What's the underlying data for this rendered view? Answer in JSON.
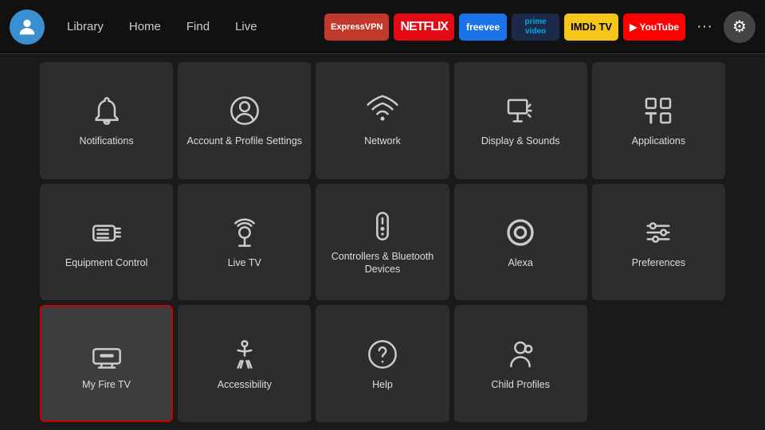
{
  "nav": {
    "links": [
      "Library",
      "Home",
      "Find",
      "Live"
    ],
    "apps": [
      {
        "id": "expressvpn",
        "label": "ExpressVPN",
        "class": "badge-expressvpn"
      },
      {
        "id": "netflix",
        "label": "NETFLIX",
        "class": "badge-netflix"
      },
      {
        "id": "freevee",
        "label": "freevee",
        "class": "badge-freevee"
      },
      {
        "id": "prime",
        "label": "prime video",
        "class": "badge-prime"
      },
      {
        "id": "imdb",
        "label": "IMDb TV",
        "class": "badge-imdb"
      },
      {
        "id": "youtube",
        "label": "▶ YouTube",
        "class": "badge-youtube"
      }
    ],
    "more_label": "···",
    "settings_label": "⚙"
  },
  "grid": {
    "items": [
      {
        "id": "notifications",
        "label": "Notifications",
        "icon": "bell",
        "selected": false
      },
      {
        "id": "account-profile",
        "label": "Account & Profile Settings",
        "icon": "user-circle",
        "selected": false
      },
      {
        "id": "network",
        "label": "Network",
        "icon": "wifi",
        "selected": false
      },
      {
        "id": "display-sounds",
        "label": "Display & Sounds",
        "icon": "display-sound",
        "selected": false
      },
      {
        "id": "applications",
        "label": "Applications",
        "icon": "apps",
        "selected": false
      },
      {
        "id": "equipment-control",
        "label": "Equipment Control",
        "icon": "tv-remote",
        "selected": false
      },
      {
        "id": "live-tv",
        "label": "Live TV",
        "icon": "antenna",
        "selected": false
      },
      {
        "id": "controllers-bluetooth",
        "label": "Controllers & Bluetooth Devices",
        "icon": "remote",
        "selected": false
      },
      {
        "id": "alexa",
        "label": "Alexa",
        "icon": "alexa",
        "selected": false
      },
      {
        "id": "preferences",
        "label": "Preferences",
        "icon": "sliders",
        "selected": false
      },
      {
        "id": "my-fire-tv",
        "label": "My Fire TV",
        "icon": "fire-tv",
        "selected": true
      },
      {
        "id": "accessibility",
        "label": "Accessibility",
        "icon": "accessibility",
        "selected": false
      },
      {
        "id": "help",
        "label": "Help",
        "icon": "help",
        "selected": false
      },
      {
        "id": "child-profiles",
        "label": "Child Profiles",
        "icon": "child",
        "selected": false
      }
    ]
  }
}
